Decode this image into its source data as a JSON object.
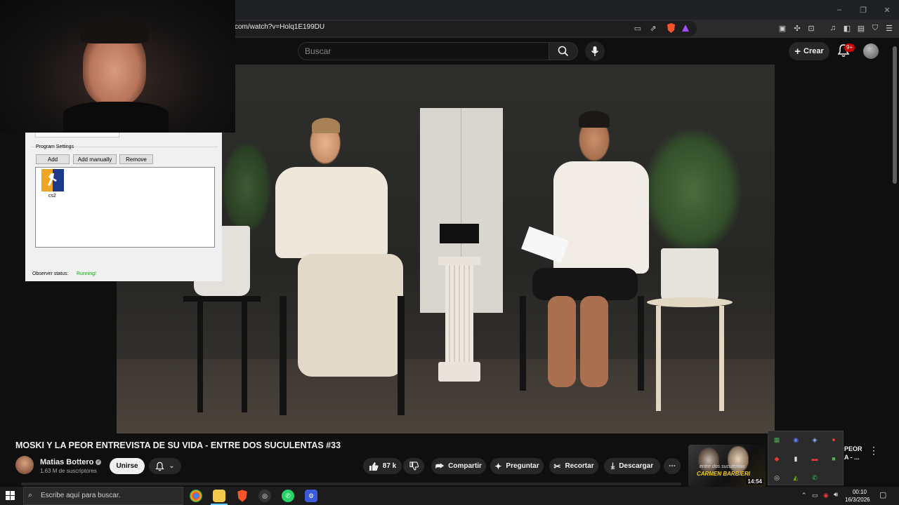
{
  "browser": {
    "url": "com/watch?v=Holq1E199DU",
    "window_controls": [
      "–",
      "❐",
      "✕"
    ]
  },
  "youtube": {
    "search_placeholder": "Buscar",
    "create_label": "Crear",
    "notif_count": "9+"
  },
  "program_settings": {
    "group_label": "Program Settings",
    "buttons": [
      "Add",
      "Add manually",
      "Remove"
    ],
    "program_name": "cs2",
    "observer_label": "Observer status:",
    "observer_value": "Running!"
  },
  "video": {
    "title": "MOSKI Y LA PEOR ENTREVISTA DE SU VIDA - ENTRE DOS SUCULENTAS #33",
    "channel": "Matias Bottero",
    "subscribers": "1.63 M de suscriptores",
    "join_label": "Unirse",
    "like_count": "87 k",
    "share_label": "Compartir",
    "ask_label": "Preguntar",
    "clip_label": "Recortar",
    "download_label": "Descargar"
  },
  "suggested": {
    "thumb_text_1": "entre dos suculentas",
    "thumb_text_2": "CARMEN BARBIERI",
    "duration": "14:54",
    "title_line1": "PEOR",
    "title_line2": "A - ..."
  },
  "taskbar": {
    "search_placeholder": "Escribe aquí para buscar.",
    "time": "00:10",
    "date": "16/3/2026"
  }
}
